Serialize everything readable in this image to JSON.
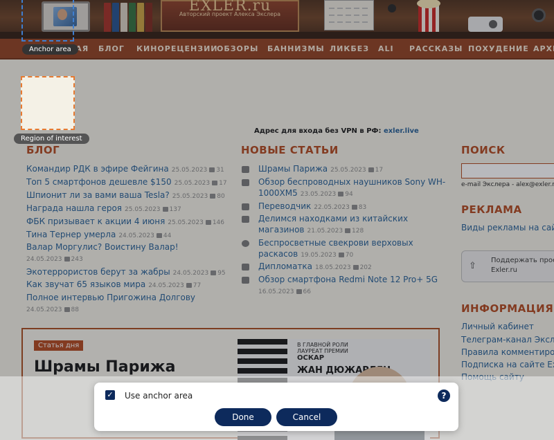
{
  "header": {
    "logo_title": "EXLER.ru",
    "logo_subtitle": "Авторский проект Алекса Экслера"
  },
  "nav": {
    "items": [
      "ГЛАВНАЯ",
      "БЛОГ",
      "КИНОРЕЦЕНЗИИ",
      "ОБЗОРЫ",
      "БАННИЗМЫ",
      "ЛИКБЕЗ",
      "ALI",
      "РАССКАЗЫ",
      "ПОХУДЕНИЕ",
      "АРХИВ"
    ]
  },
  "vpn": {
    "text": "Адрес для входа без VPN в РФ:",
    "link": "exler.live"
  },
  "blog": {
    "title": "БЛОГ",
    "items": [
      {
        "title": "Командир РДК в эфире Фейгина",
        "date": "25.05.2023",
        "comments": "31"
      },
      {
        "title": "Топ 5 смартфонов дешевле $150",
        "date": "25.05.2023",
        "comments": "17"
      },
      {
        "title": "Шпионит ли за вами ваша Tesla?",
        "date": "25.05.2023",
        "comments": "80"
      },
      {
        "title": "Награда нашла героя",
        "date": "25.05.2023",
        "comments": "137"
      },
      {
        "title": "ФБК призывает к акции 4 июня",
        "date": "25.05.2023",
        "comments": "146"
      },
      {
        "title": "Тина Тернер умерла",
        "date": "24.05.2023",
        "comments": "44"
      },
      {
        "title": "Валар Моргулис? Воистину Валар!",
        "date": "24.05.2023",
        "comments": "243"
      },
      {
        "title": "Экотеррористов берут за жабры",
        "date": "24.05.2023",
        "comments": "95"
      },
      {
        "title": "Как звучат 65 языков мира",
        "date": "24.05.2023",
        "comments": "77"
      },
      {
        "title": "Полное интервью Пригожина Долгову",
        "date": "24.05.2023",
        "comments": "88"
      }
    ]
  },
  "articles": {
    "title": "НОВЫЕ СТАТЬИ",
    "items": [
      {
        "line1": "Шрамы Парижа",
        "line2": "",
        "date": "25.05.2023",
        "comments": "17"
      },
      {
        "line1": "Обзор беспроводных наушников Sony WH-",
        "line2": "1000XM5",
        "date": "23.05.2023",
        "comments": "94"
      },
      {
        "line1": "Переводчик",
        "line2": "",
        "date": "22.05.2023",
        "comments": "83"
      },
      {
        "line1": "Делимся находками из китайских",
        "line2": "магазинов",
        "date": "21.05.2023",
        "comments": "128"
      },
      {
        "line1": "Беспросветные свекрови верховых",
        "line2": "раскасов",
        "date": "19.05.2023",
        "comments": "70"
      },
      {
        "line1": "Дипломатка",
        "line2": "",
        "date": "18.05.2023",
        "comments": "202"
      },
      {
        "line1": "Обзор смартфона Redmi Note 12 Pro+ 5G",
        "line2": "",
        "date": "16.05.2023",
        "comments": "66"
      }
    ]
  },
  "sidebar": {
    "search_title": "ПОИСК",
    "email": "e-mail Экслера - alex@exler.ru",
    "ads_title": "РЕКЛАМА",
    "ads_link": "Виды рекламы на сайте",
    "support_line1": "Поддержать проект",
    "support_line2": "Exler.ru",
    "info_title": "ИНФОРМАЦИЯ",
    "info_links": [
      "Личный кабинет",
      "Телеграм-канал Экслера",
      "Правила комментирования",
      "Подписка на сайте Exler",
      "Помощь сайту"
    ]
  },
  "featured": {
    "badge": "Статья дня",
    "title": "Шрамы Парижа",
    "poster_lines": [
      "В ГЛАВНОЙ РОЛИ",
      "ЛАУРЕАТ ПРЕМИИ",
      "ОСКАР"
    ],
    "poster_name": "ЖАН ДЮЖАРДЕН"
  },
  "overlay": {
    "anchor_label": "Anchor area",
    "roi_label": "Region of interest"
  },
  "dialog": {
    "checkbox_label": "Use anchor area",
    "checked": true,
    "help": "?",
    "done_label": "Done",
    "cancel_label": "Cancel"
  }
}
